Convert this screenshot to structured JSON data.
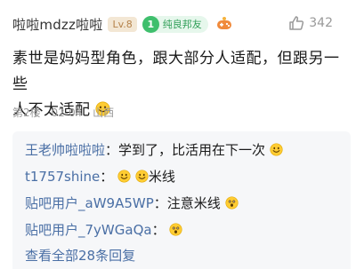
{
  "post": {
    "username": "啦啦mdzz啦啦",
    "level": "Lv.8",
    "badge_number": "1",
    "badge_label": "纯良邦友",
    "like_count": "342",
    "content_line1": "素世是妈妈型角色，跟大部分人适配，但跟另一些",
    "content_line2": "人不太适配",
    "floor": "第2楼",
    "date": "02-04",
    "location": "山西"
  },
  "replies": [
    {
      "user": "王老帅啦啦啦",
      "sep": "：",
      "text": "学到了，比活用在下一次",
      "emojis_after": [
        "smile-emoji"
      ]
    },
    {
      "user": "t1757shine",
      "sep": "：",
      "emojis_before": [
        "smile-emoji",
        "smile-emoji"
      ],
      "text": "米线"
    },
    {
      "user": "贴吧用户_aW9A5WP",
      "sep": "：",
      "text": "注意米线",
      "emojis_after": [
        "shocked-emoji"
      ]
    },
    {
      "user": "贴吧用户_7yWGaQa",
      "sep": "：",
      "text": "",
      "emojis_after": [
        "shocked-emoji"
      ]
    }
  ],
  "view_all_label": "查看全部28条回复",
  "colors": {
    "link": "#4a6fa5",
    "badge_green": "#3fbf6d",
    "level_bg": "#f3e7d4",
    "reply_bg": "#f6f7f9",
    "emoji_yellow": "#ffcc33"
  }
}
